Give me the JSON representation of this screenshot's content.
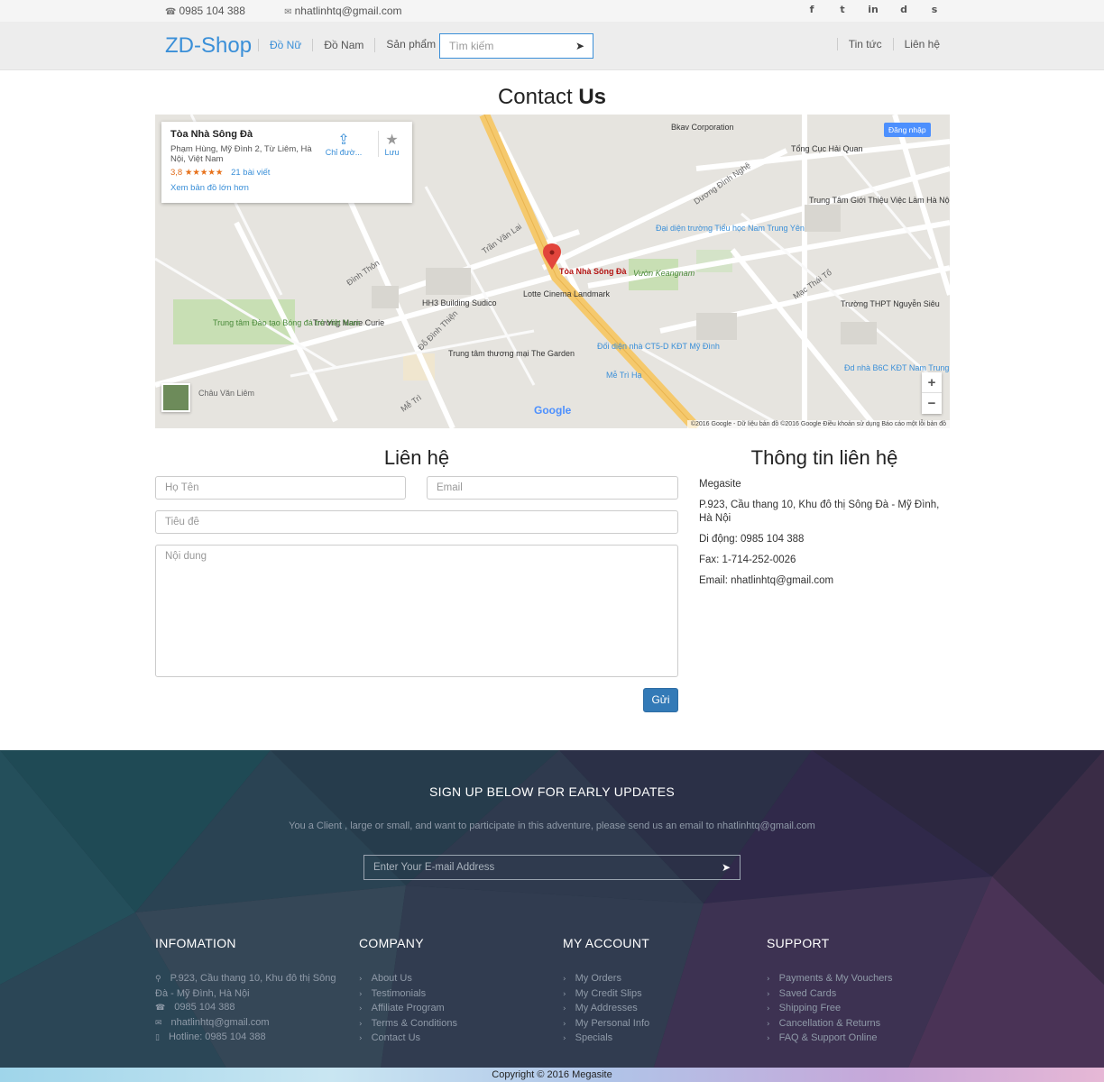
{
  "topbar": {
    "phone": "0985 104 388",
    "email": "nhatlinhtq@gmail.com",
    "social": [
      "f",
      "t",
      "in",
      "d",
      "s"
    ]
  },
  "header": {
    "logo": "ZD-Shop",
    "nav": [
      "Đồ Nữ",
      "Đồ Nam",
      "Sản phẩm"
    ],
    "search_placeholder": "Tìm kiếm",
    "nav_right": [
      "Tin tức",
      "Liên hệ"
    ]
  },
  "page": {
    "title_part1": "Contact ",
    "title_part2": "Us"
  },
  "map": {
    "card": {
      "name": "Tòa Nhà Sông Đà",
      "address": "Phạm Hùng, Mỹ Đình 2, Từ Liêm, Hà Nội, Việt Nam",
      "rating": "3,8",
      "stars": "★★★★★",
      "reviews": "21 bài viết",
      "bigger_map": "Xem bản đồ lớn hơn",
      "directions": "Chỉ đườ...",
      "save": "Lưu"
    },
    "login": "Đăng nhập",
    "marker_label": "Tòa Nhà Sông Đà",
    "labels": [
      "Bkav Corporation",
      "Tổng Cục Hải Quan",
      "Trung Tâm Giới Thiệu Việc Làm Hà Nội",
      "Đại diện trường Tiểu học Nam Trung Yên",
      "Vườn Keangnam",
      "Lotte Cinema Landmark",
      "HH3 Building Sudico",
      "Trường Marie Curie",
      "Trung tâm Đào tạo Bóng đá trẻ Việt Nam",
      "Trung tâm thương mại The Garden",
      "Đối diện nhà CT5-D KĐT Mỹ Đình",
      "Mễ Trì Hạ",
      "Trường THPT Nguyễn Siêu",
      "Đd nhà B6C KĐT Nam Trung Yên",
      "Dương Đình Nghệ",
      "Mạc Thái Tổ",
      "Đình Thôn",
      "Trần Văn Lai",
      "Mễ Trì",
      "Đỗ Đình Thiện",
      "Châu Văn Liêm"
    ],
    "google": "Google",
    "footer": "©2016 Google - Dữ liệu bản đồ ©2016 Google   Điều khoản sử dụng   Báo cáo một lỗi bản đồ",
    "zoom_in": "+",
    "zoom_out": "−"
  },
  "form": {
    "title": "Liên hệ",
    "name_placeholder": "Họ Tên",
    "email_placeholder": "Email",
    "subject_placeholder": "Tiêu đề",
    "message_placeholder": "Nội dung",
    "submit": "Gửi"
  },
  "info": {
    "title": "Thông tin liên hệ",
    "company": "Megasite",
    "address": "P.923, Cầu thang 10, Khu đô thị Sông Đà - Mỹ Đình, Hà Nội",
    "mobile": "Di động: 0985 104 388",
    "fax": "Fax: 1-714-252-0026",
    "email": "Email: nhatlinhtq@gmail.com"
  },
  "footer": {
    "signup_title": "SIGN UP BELOW FOR EARLY UPDATES",
    "signup_desc": "You a Client , large or small, and want to participate in this adventure, please send us an email to nhatlinhtq@gmail.com",
    "signup_placeholder": "Enter Your E-mail Address",
    "columns": [
      {
        "title": "INFOMATION",
        "items": [
          "P.923, Cầu thang 10, Khu đô thị Sông Đà - Mỹ Đình, Hà Nội",
          "0985 104 388",
          "nhatlinhtq@gmail.com",
          "Hotline: 0985 104 388"
        ]
      },
      {
        "title": "COMPANY",
        "items": [
          "About Us",
          "Testimonials",
          "Affiliate Program",
          "Terms & Conditions",
          "Contact Us"
        ]
      },
      {
        "title": "MY ACCOUNT",
        "items": [
          "My Orders",
          "My Credit Slips",
          "My Addresses",
          "My Personal Info",
          "Specials"
        ]
      },
      {
        "title": "SUPPORT",
        "items": [
          "Payments & My Vouchers",
          "Saved Cards",
          "Shipping Free",
          "Cancellation & Returns",
          "FAQ & Support Online"
        ]
      }
    ],
    "copyright": "Copyright © 2016 Megasite"
  }
}
